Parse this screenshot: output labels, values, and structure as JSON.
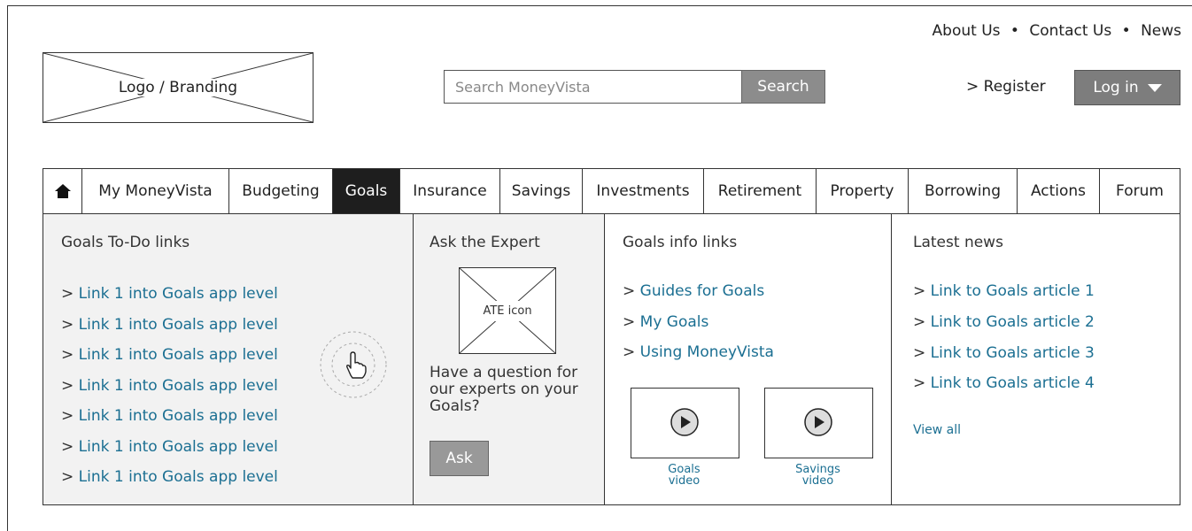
{
  "utility_nav": {
    "about": "About Us",
    "contact": "Contact Us",
    "news": "News",
    "separator": "•"
  },
  "logo": {
    "label": "Logo / Branding"
  },
  "search": {
    "placeholder": "Search MoneyVista",
    "button": "Search"
  },
  "account": {
    "register": "> Register",
    "login": "Log in"
  },
  "nav": {
    "home_icon": "home-icon",
    "items": [
      {
        "label": "My MoneyVista"
      },
      {
        "label": "Budgeting"
      },
      {
        "label": "Goals"
      },
      {
        "label": "Insurance"
      },
      {
        "label": "Savings"
      },
      {
        "label": "Investments"
      },
      {
        "label": "Retirement"
      },
      {
        "label": "Property"
      },
      {
        "label": "Borrowing"
      },
      {
        "label": "Actions"
      },
      {
        "label": "Forum"
      }
    ],
    "active": "Goals"
  },
  "todo": {
    "title": "Goals To-Do links",
    "prefix": "> ",
    "links": [
      "Link 1 into Goals app level",
      "Link 1 into Goals app level",
      "Link 1 into Goals app level",
      "Link 1 into Goals app level",
      "Link 1 into Goals app level",
      "Link 1 into Goals app level",
      "Link 1 into Goals app level"
    ]
  },
  "expert": {
    "title": "Ask the Expert",
    "icon_label": "ATE icon",
    "question": "Have a question for our experts on your Goals?",
    "button": "Ask"
  },
  "info": {
    "title": "Goals info links",
    "prefix": "> ",
    "links": [
      "Guides for Goals",
      "My Goals",
      "Using MoneyVista"
    ],
    "videos": [
      {
        "label": "Goals video",
        "line1": "Goals",
        "line2": "video"
      },
      {
        "label": "Savings video",
        "line1": "Savings",
        "line2": "video"
      }
    ]
  },
  "news": {
    "title": "Latest news",
    "prefix": "> ",
    "links": [
      "Link to Goals article 1",
      "Link to Goals article 2",
      "Link to Goals article 3",
      "Link to Goals article 4"
    ],
    "view_all": "View all"
  },
  "colors": {
    "link": "#1b6f92",
    "active_tab": "#1e1e1e",
    "panel_gray": "#f2f2f2",
    "button_gray": "#8c8c8c"
  }
}
